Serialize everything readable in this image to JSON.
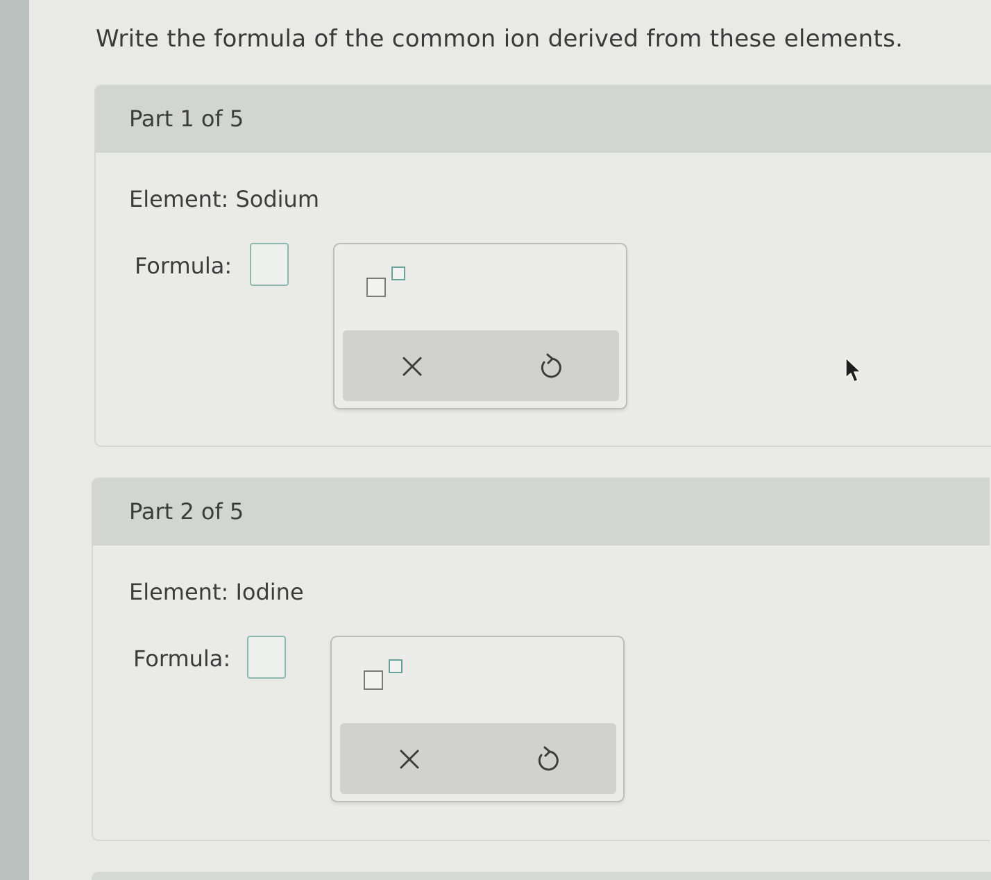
{
  "question": {
    "prompt": "Write the formula of the common ion derived from these elements."
  },
  "parts": [
    {
      "title": "Part 1 of 5",
      "element_text": "Element: Sodium",
      "formula_label": "Formula:",
      "formula_value": ""
    },
    {
      "title": "Part 2 of 5",
      "element_text": "Element: Iodine",
      "formula_label": "Formula:",
      "formula_value": ""
    }
  ],
  "palette": {
    "tools": [
      "superscript-icon"
    ],
    "actions": [
      "clear-icon",
      "undo-icon"
    ]
  },
  "colors": {
    "header_bg": "#d3d5d2",
    "input_border": "#8fb7b1",
    "action_bar_bg": "#d1d1ce"
  }
}
